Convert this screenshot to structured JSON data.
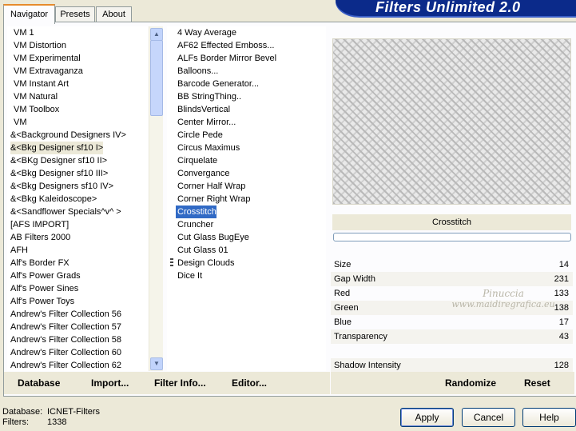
{
  "title": "Filters Unlimited 2.0",
  "tabs": [
    "Navigator",
    "Presets",
    "About"
  ],
  "categories": [
    "VM 1",
    "VM Distortion",
    "VM Experimental",
    "VM Extravaganza",
    "VM Instant Art",
    "VM Natural",
    "VM Toolbox",
    "VM",
    "&<Background Designers IV>",
    "&<Bkg Designer sf10 I>",
    "&<BKg Designer sf10 II>",
    "&<Bkg Designer sf10 III>",
    "&<Bkg Designers sf10 IV>",
    "&<Bkg Kaleidoscope>",
    "&<Sandflower Specials^v^ >",
    "[AFS IMPORT]",
    "AB Filters 2000",
    "AFH",
    "Alf's Border FX",
    "Alf's Power Grads",
    "Alf's Power Sines",
    "Alf's Power Toys",
    "Andrew's Filter Collection 56",
    "Andrew's Filter Collection 57",
    "Andrew's Filter Collection 58",
    "Andrew's Filter Collection 60",
    "Andrew's Filter Collection 62"
  ],
  "selected_category": "&<Bkg Designer sf10 I>",
  "filters": [
    "4 Way Average",
    "AF62 Effected Emboss...",
    "ALFs Border Mirror Bevel",
    "Balloons...",
    "Barcode Generator...",
    "BB StringThing..",
    "BlindsVertical",
    "Center Mirror...",
    "Circle Pede",
    "Circus Maximus",
    "Cirquelate",
    "Convergance",
    "Corner Half Wrap",
    "Corner Right Wrap",
    "Crosstitch",
    "Cruncher",
    "Cut Glass  BugEye",
    "Cut Glass 01",
    "Design Clouds",
    "Dice It"
  ],
  "selected_filter": "Crosstitch",
  "preview_label": "Crosstitch",
  "parameters": [
    {
      "label": "Size",
      "value": "14"
    },
    {
      "label": "Gap Width",
      "value": "231"
    },
    {
      "label": "Red",
      "value": "133"
    },
    {
      "label": "Green",
      "value": "138"
    },
    {
      "label": "Blue",
      "value": "17"
    },
    {
      "label": "Transparency",
      "value": "43"
    },
    {
      "label": "",
      "value": ""
    },
    {
      "label": "Shadow Intensity",
      "value": "128"
    }
  ],
  "watermark": {
    "line1": "Pinuccia",
    "line2": "www.maidiregrafica.eu"
  },
  "bottom_left_buttons": {
    "database": "Database",
    "import": "Import...",
    "filter_info": "Filter Info...",
    "editor": "Editor..."
  },
  "bottom_right_buttons": {
    "randomize": "Randomize",
    "reset": "Reset"
  },
  "dialog_buttons": {
    "apply": "Apply",
    "cancel": "Cancel",
    "help": "Help"
  },
  "status": {
    "database_label": "Database:",
    "database_value": "ICNET-Filters",
    "filters_label": "Filters:",
    "filters_value": "1338"
  }
}
